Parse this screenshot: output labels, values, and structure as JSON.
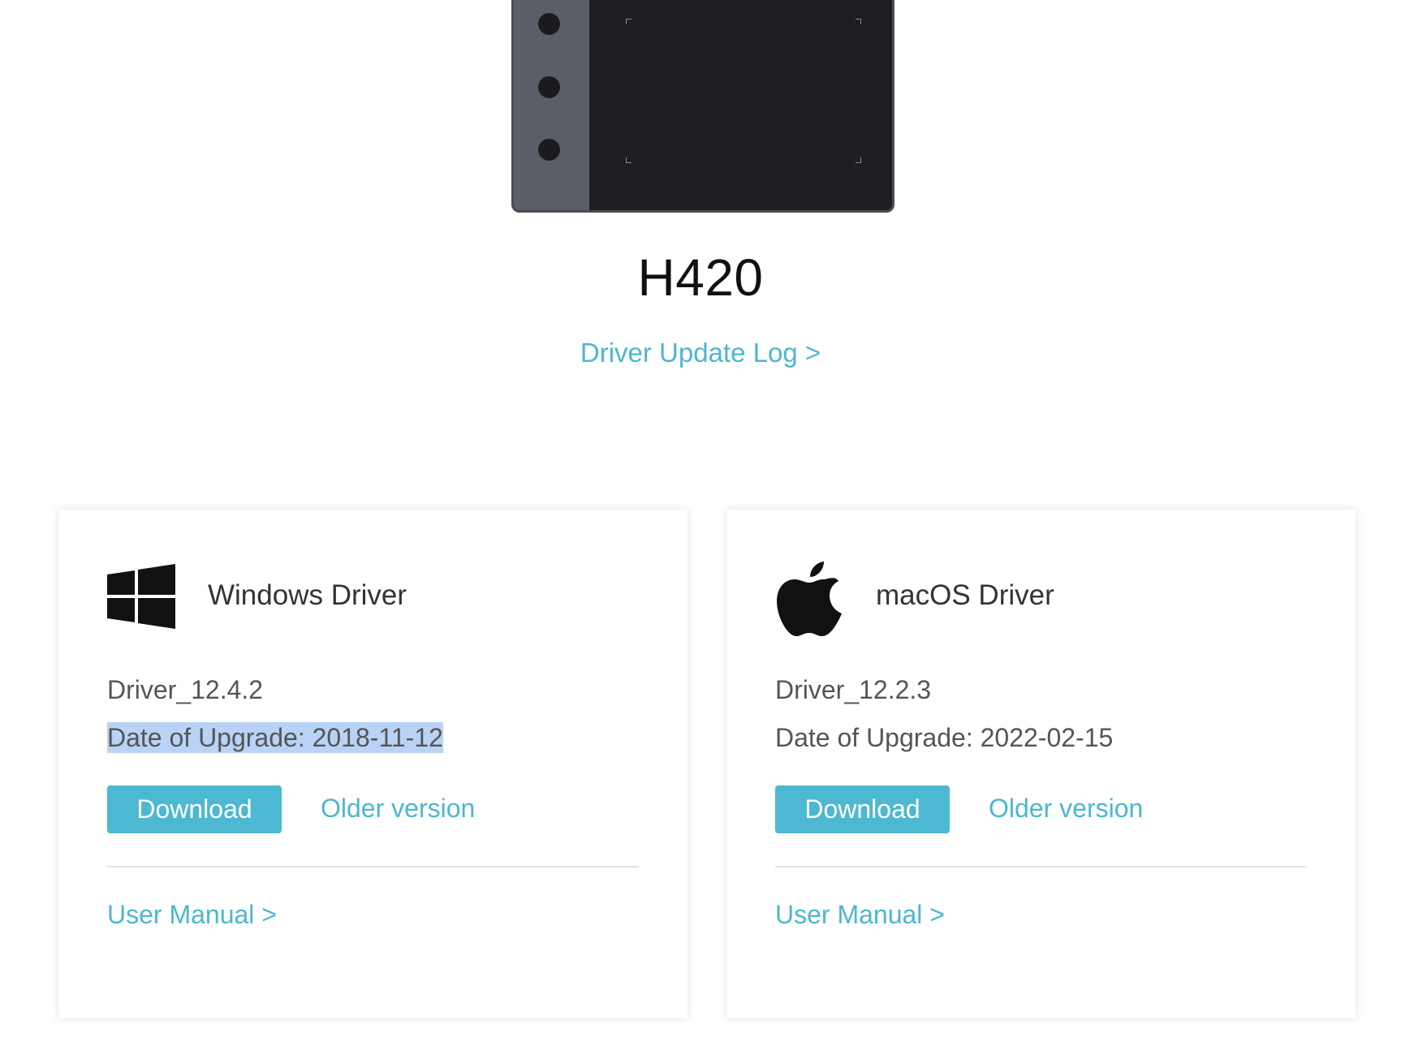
{
  "product": {
    "name": "H420",
    "update_log_link": "Driver Update Log >"
  },
  "drivers": [
    {
      "os": "Windows Driver",
      "icon": "windows-logo-icon",
      "version": "Driver_12.4.2",
      "upgrade_date": "Date of Upgrade: 2018-11-12",
      "download_label": "Download",
      "older_label": "Older version",
      "manual_label": "User Manual >"
    },
    {
      "os": "macOS Driver",
      "icon": "apple-logo-icon",
      "version": "Driver_12.2.3",
      "upgrade_date": "Date of Upgrade: 2022-02-15",
      "download_label": "Download",
      "older_label": "Older version",
      "manual_label": "User Manual >"
    }
  ],
  "colors": {
    "accent": "#4cb8d1",
    "link": "#4db7cf",
    "selection": "#b8d3f5"
  }
}
